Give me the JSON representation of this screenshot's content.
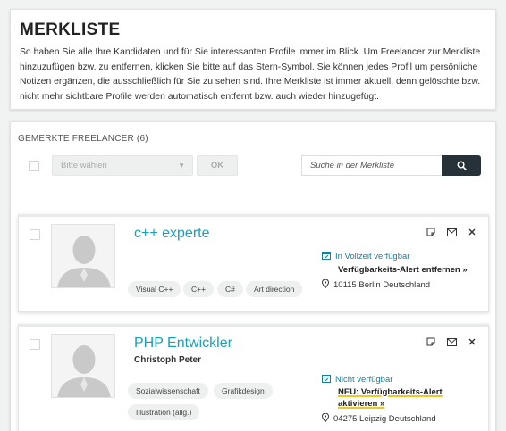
{
  "info": {
    "title": "MERKLISTE",
    "description": "So haben Sie alle Ihre Kandidaten und für Sie interessanten Profile immer im Blick. Um Freelancer zur Merkliste hinzuzufügen bzw. zu entfernen, klicken Sie bitte auf das Stern-Symbol. Sie können jedes Profil um persönliche Notizen ergänzen, die ausschließlich für Sie zu sehen sind. Ihre Merkliste ist immer aktuell, denn gelöschte bzw. nicht mehr sichtbare Profile werden automatisch entfernt bzw. auch wieder hinzugefügt."
  },
  "list": {
    "title": "GEMERKTE FREELANCER (6)",
    "bulk_select_placeholder": "Bitte wählen",
    "ok_label": "OK",
    "search_placeholder": "Suche in der Merkliste"
  },
  "freelancers": [
    {
      "name": "c++ experte",
      "subtitle": "",
      "tags": [
        "Visual C++",
        "C++",
        "C#",
        "Art direction"
      ],
      "availability": "In Vollzeit verfügbar",
      "alert_link": "Verfügbarkeits-Alert entfernen »",
      "location": "10115 Berlin Deutschland"
    },
    {
      "name": "PHP Entwickler",
      "subtitle": "Christoph Peter",
      "tags": [
        "Sozialwissenschaft",
        "Grafikdesign",
        "Illustration (allg.)"
      ],
      "availability": "Nicht verfügbar",
      "alert_link_line1": "NEU: Verfügbarkeits-Alert",
      "alert_link_line2": "aktivieren »",
      "location": "04275 Leipzig Deutschland"
    }
  ],
  "colors": {
    "accent": "#1aa0b7",
    "search_button": "#263237",
    "highlight": "#f3c623"
  }
}
